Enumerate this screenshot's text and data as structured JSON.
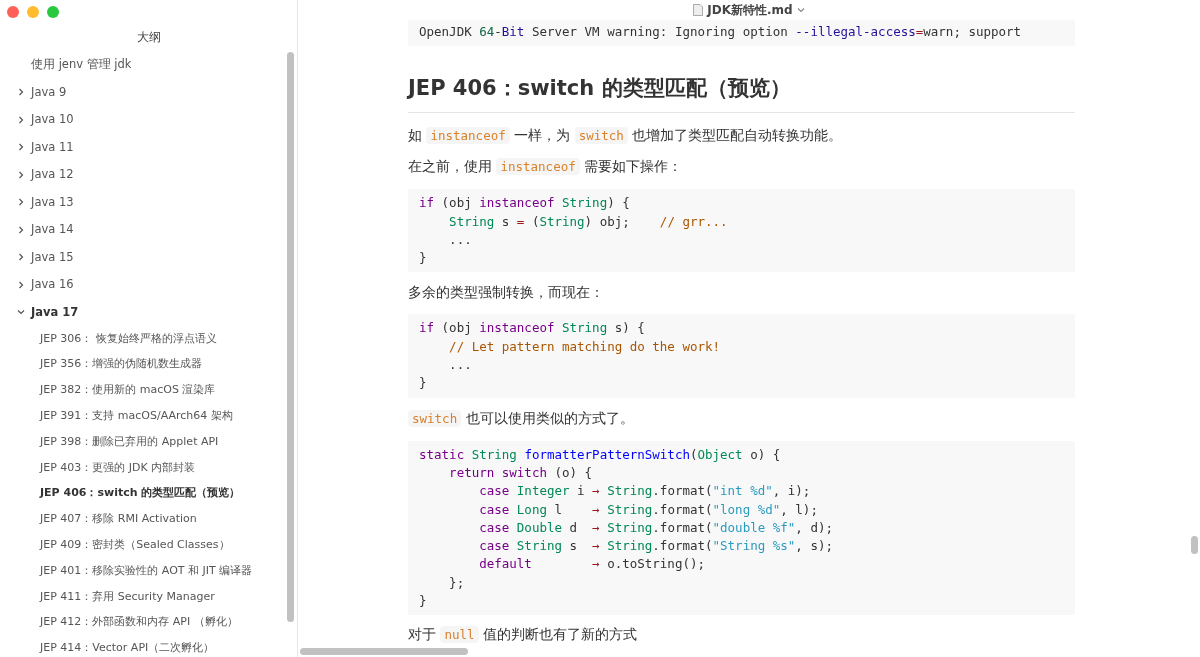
{
  "window": {
    "title": "JDK新特性.md"
  },
  "outline": {
    "title": "大纲",
    "items": [
      {
        "label": "使用 jenv 管理 jdk",
        "kind": "leaf",
        "expanded": false
      },
      {
        "label": "Java 9",
        "kind": "group",
        "expanded": false
      },
      {
        "label": "Java 10",
        "kind": "group",
        "expanded": false
      },
      {
        "label": "Java 11",
        "kind": "group",
        "expanded": false
      },
      {
        "label": "Java 12",
        "kind": "group",
        "expanded": false
      },
      {
        "label": "Java 13",
        "kind": "group",
        "expanded": false
      },
      {
        "label": "Java 14",
        "kind": "group",
        "expanded": false
      },
      {
        "label": "Java 15",
        "kind": "group",
        "expanded": false
      },
      {
        "label": "Java 16",
        "kind": "group",
        "expanded": false
      },
      {
        "label": "Java 17",
        "kind": "group",
        "expanded": true,
        "children": [
          {
            "label": "JEP 306： 恢复始终严格的浮点语义",
            "selected": false
          },
          {
            "label": "JEP 356：增强的伪随机数生成器",
            "selected": false
          },
          {
            "label": "JEP 382：使用新的 macOS 渲染库",
            "selected": false
          },
          {
            "label": "JEP 391：支持 macOS/AArch64 架构",
            "selected": false
          },
          {
            "label": "JEP 398：删除已弃用的 Applet API",
            "selected": false
          },
          {
            "label": "JEP 403：更强的 JDK 内部封装",
            "selected": false
          },
          {
            "label": "JEP 406：switch 的类型匹配（预览）",
            "selected": true
          },
          {
            "label": "JEP 407：移除 RMI Activation",
            "selected": false
          },
          {
            "label": "JEP 409：密封类（Sealed Classes）",
            "selected": false
          },
          {
            "label": "JEP 401：移除实验性的 AOT 和 JIT 编译器",
            "selected": false
          },
          {
            "label": "JEP 411：弃用 Security Manager",
            "selected": false
          },
          {
            "label": "JEP 412：外部函数和内存 API （孵化）",
            "selected": false
          },
          {
            "label": "JEP 414：Vector API（二次孵化）",
            "selected": false
          }
        ]
      }
    ]
  },
  "document": [
    {
      "kind": "code",
      "lines": [
        [
          {
            "kind": "plain",
            "text": "OpenJDK "
          },
          {
            "kind": "number",
            "text": "64"
          },
          {
            "kind": "plain",
            "text": "-"
          },
          {
            "kind": "builtin",
            "text": "Bit"
          },
          {
            "kind": "plain",
            "text": " Server VM warning: Ignoring option "
          },
          {
            "kind": "builtin",
            "text": "--illegal-access"
          },
          {
            "kind": "operator",
            "text": "="
          },
          {
            "kind": "plain",
            "text": "warn; support"
          }
        ]
      ]
    },
    {
      "kind": "heading",
      "text": "JEP 406：switch 的类型匹配（预览）"
    },
    {
      "kind": "paragraph",
      "parts": [
        {
          "kind": "text",
          "text": "如 "
        },
        {
          "kind": "code",
          "text": "instanceof"
        },
        {
          "kind": "text",
          "text": " 一样，为 "
        },
        {
          "kind": "code",
          "text": "switch"
        },
        {
          "kind": "text",
          "text": " 也增加了类型匹配自动转换功能。"
        }
      ]
    },
    {
      "kind": "paragraph",
      "parts": [
        {
          "kind": "text",
          "text": "在之前，使用 "
        },
        {
          "kind": "code",
          "text": "instanceof"
        },
        {
          "kind": "text",
          "text": " 需要如下操作："
        }
      ]
    },
    {
      "kind": "code",
      "lines": [
        [
          {
            "kind": "keyword",
            "text": "if"
          },
          {
            "kind": "plain",
            "text": " (obj "
          },
          {
            "kind": "keyword",
            "text": "instanceof "
          },
          {
            "kind": "type",
            "text": "String"
          },
          {
            "kind": "plain",
            "text": ") {"
          }
        ],
        [
          {
            "kind": "type",
            "text": "    String"
          },
          {
            "kind": "plain",
            "text": " s "
          },
          {
            "kind": "operator",
            "text": "="
          },
          {
            "kind": "plain",
            "text": " ("
          },
          {
            "kind": "type",
            "text": "String"
          },
          {
            "kind": "plain",
            "text": ") obj;    "
          },
          {
            "kind": "comment",
            "text": "// grr..."
          }
        ],
        [
          {
            "kind": "plain",
            "text": "    ..."
          }
        ],
        [
          {
            "kind": "plain",
            "text": "}"
          }
        ]
      ]
    },
    {
      "kind": "paragraph",
      "parts": [
        {
          "kind": "text",
          "text": "多余的类型强制转换，而现在："
        }
      ]
    },
    {
      "kind": "code",
      "lines": [
        [
          {
            "kind": "keyword",
            "text": "if"
          },
          {
            "kind": "plain",
            "text": " (obj "
          },
          {
            "kind": "keyword",
            "text": "instanceof "
          },
          {
            "kind": "type",
            "text": "String"
          },
          {
            "kind": "plain",
            "text": " s) {"
          }
        ],
        [
          {
            "kind": "comment",
            "text": "    // Let pattern matching do the work!"
          }
        ],
        [
          {
            "kind": "plain",
            "text": "    ..."
          }
        ],
        [
          {
            "kind": "plain",
            "text": "}"
          }
        ]
      ]
    },
    {
      "kind": "paragraph",
      "parts": [
        {
          "kind": "code",
          "text": "switch"
        },
        {
          "kind": "text",
          "text": " 也可以使用类似的方式了。"
        }
      ]
    },
    {
      "kind": "code",
      "lines": [
        [
          {
            "kind": "keyword",
            "text": "static "
          },
          {
            "kind": "type",
            "text": "String "
          },
          {
            "kind": "func",
            "text": "formatterPatternSwitch"
          },
          {
            "kind": "plain",
            "text": "("
          },
          {
            "kind": "type",
            "text": "Object"
          },
          {
            "kind": "plain",
            "text": " o) {"
          }
        ],
        [
          {
            "kind": "keyword",
            "text": "    return switch"
          },
          {
            "kind": "plain",
            "text": " (o) {"
          }
        ],
        [
          {
            "kind": "keyword",
            "text": "        case "
          },
          {
            "kind": "type",
            "text": "Integer"
          },
          {
            "kind": "plain",
            "text": " i "
          },
          {
            "kind": "arrow",
            "text": "→ "
          },
          {
            "kind": "type",
            "text": "String"
          },
          {
            "kind": "plain",
            "text": ".format("
          },
          {
            "kind": "string",
            "text": "\"int %d\""
          },
          {
            "kind": "plain",
            "text": ", i);"
          }
        ],
        [
          {
            "kind": "keyword",
            "text": "        case "
          },
          {
            "kind": "type",
            "text": "Long"
          },
          {
            "kind": "plain",
            "text": " l    "
          },
          {
            "kind": "arrow",
            "text": "→ "
          },
          {
            "kind": "type",
            "text": "String"
          },
          {
            "kind": "plain",
            "text": ".format("
          },
          {
            "kind": "string",
            "text": "\"long %d\""
          },
          {
            "kind": "plain",
            "text": ", l);"
          }
        ],
        [
          {
            "kind": "keyword",
            "text": "        case "
          },
          {
            "kind": "type",
            "text": "Double"
          },
          {
            "kind": "plain",
            "text": " d  "
          },
          {
            "kind": "arrow",
            "text": "→ "
          },
          {
            "kind": "type",
            "text": "String"
          },
          {
            "kind": "plain",
            "text": ".format("
          },
          {
            "kind": "string",
            "text": "\"double %f\""
          },
          {
            "kind": "plain",
            "text": ", d);"
          }
        ],
        [
          {
            "kind": "keyword",
            "text": "        case "
          },
          {
            "kind": "type",
            "text": "String"
          },
          {
            "kind": "plain",
            "text": " s  "
          },
          {
            "kind": "arrow",
            "text": "→ "
          },
          {
            "kind": "type",
            "text": "String"
          },
          {
            "kind": "plain",
            "text": ".format("
          },
          {
            "kind": "string",
            "text": "\"String %s\""
          },
          {
            "kind": "plain",
            "text": ", s);"
          }
        ],
        [
          {
            "kind": "keyword",
            "text": "        default        "
          },
          {
            "kind": "arrow",
            "text": "→"
          },
          {
            "kind": "plain",
            "text": " o.toString();"
          }
        ],
        [
          {
            "kind": "plain",
            "text": "    };"
          }
        ],
        [
          {
            "kind": "plain",
            "text": "}"
          }
        ]
      ]
    },
    {
      "kind": "paragraph",
      "parts": [
        {
          "kind": "text",
          "text": "对于 "
        },
        {
          "kind": "code",
          "text": "null"
        },
        {
          "kind": "text",
          "text": " 值的判断也有了新的方式"
        }
      ]
    }
  ]
}
